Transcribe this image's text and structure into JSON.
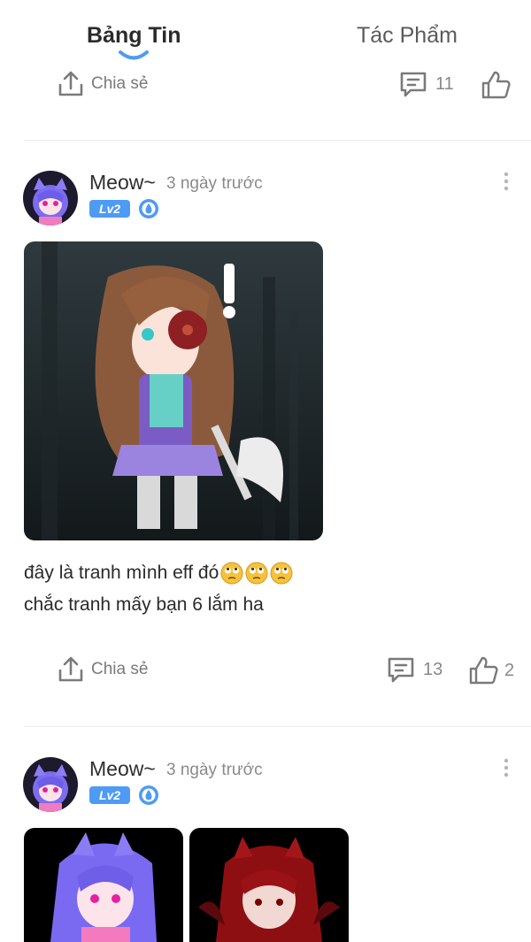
{
  "tabs": [
    {
      "label": "Bảng Tin",
      "active": true
    },
    {
      "label": "Tác Phẩm",
      "active": false
    }
  ],
  "colors": {
    "accent": "#4e9bf3",
    "icon_gray": "#7a7a7a",
    "text_dark": "#2b2b2b",
    "divider": "#ececec"
  },
  "prev_post": {
    "share_label": "Chia sẻ",
    "comment_count": "11",
    "like_count": ""
  },
  "posts": [
    {
      "author": "Meow~",
      "time": "3 ngày trước",
      "level": "Lv2",
      "text_line1": "đây là tranh mình eff đó",
      "text_line2": "chắc tranh mấy bạn 6 lắm ha",
      "emojis": [
        "eye-roll-emoji",
        "eye-roll-emoji",
        "eye-roll-emoji"
      ],
      "share_label": "Chia sẻ",
      "comment_count": "13",
      "like_count": "2"
    },
    {
      "author": "Meow~",
      "time": "3 ngày trước",
      "level": "Lv2"
    }
  ],
  "icons": [
    "share-icon",
    "comment-icon",
    "thumbs-up-icon",
    "more-vertical-icon",
    "verified-badge-icon"
  ]
}
